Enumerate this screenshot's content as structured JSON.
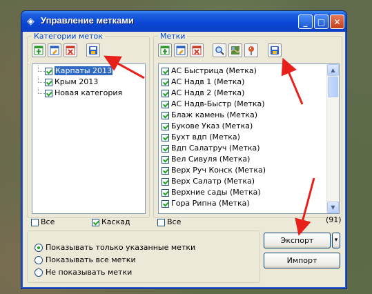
{
  "window": {
    "title": "Управление метками",
    "controls": [
      "_",
      "□",
      "✕"
    ]
  },
  "categories": {
    "legend": "Категории меток",
    "toolbar": [
      {
        "name": "add-category-button",
        "icon": "add-icon",
        "color": "#2e9a2e"
      },
      {
        "name": "edit-category-button",
        "icon": "edit-icon",
        "color": "#2c5fbf"
      },
      {
        "name": "delete-category-button",
        "icon": "delete-icon",
        "color": "#c93a2a"
      },
      {
        "name": "save-category-button",
        "icon": "save-icon",
        "color": "#2a62c9"
      }
    ],
    "items": [
      {
        "label": "Карпаты 2013",
        "checked": true,
        "selected": true
      },
      {
        "label": "Крым 2013",
        "checked": true,
        "selected": false
      },
      {
        "label": "Новая категория",
        "checked": true,
        "selected": false
      }
    ],
    "all_label": "Все",
    "all_checked": false,
    "cascade_label": "Каскад",
    "cascade_checked": true
  },
  "marks": {
    "legend": "Метки",
    "toolbar": [
      {
        "name": "add-mark-button",
        "icon": "add-icon",
        "color": "#2e9a2e"
      },
      {
        "name": "edit-mark-button",
        "icon": "edit-icon",
        "color": "#2c5fbf"
      },
      {
        "name": "delete-mark-button",
        "icon": "delete-icon",
        "color": "#c93a2a"
      },
      {
        "name": "find-mark-button",
        "icon": "search-icon",
        "color": "#2a62c9"
      },
      {
        "name": "map-mark-button",
        "icon": "map-icon",
        "color": "#5a8a3a"
      },
      {
        "name": "pin-mark-button",
        "icon": "pin-icon",
        "color": "#d8562a"
      },
      {
        "name": "save-mark-button",
        "icon": "save-icon",
        "color": "#2a62c9"
      }
    ],
    "items": [
      "АС Быстрица (Метка)",
      "АС Надв 1 (Метка)",
      "АС Надв 2 (Метка)",
      "АС Надв-Быстр (Метка)",
      "Блаж камень (Метка)",
      "Букове Указ (Метка)",
      "Бухт вдп (Метка)",
      "Вдп Салатруч (Метка)",
      "Вел Сивуля (Метка)",
      "Верх Руч Конск (Метка)",
      "Верх Салатр (Метка)",
      "Верхние сады (Метка)",
      "Гора Рипна (Метка)"
    ],
    "all_label": "Все",
    "all_checked": false,
    "count": "(91)"
  },
  "display_options": {
    "options": [
      {
        "label": "Показывать только указанные метки",
        "checked": true
      },
      {
        "label": "Показывать все метки",
        "checked": false
      },
      {
        "label": "Не показывать метки",
        "checked": false
      }
    ]
  },
  "actions": {
    "export_label": "Экспорт",
    "import_label": "Импорт",
    "dropdown_glyph": "▾"
  },
  "colors": {
    "annotation_arrow": "#e8201c",
    "title_bar": "#0a46d4"
  }
}
